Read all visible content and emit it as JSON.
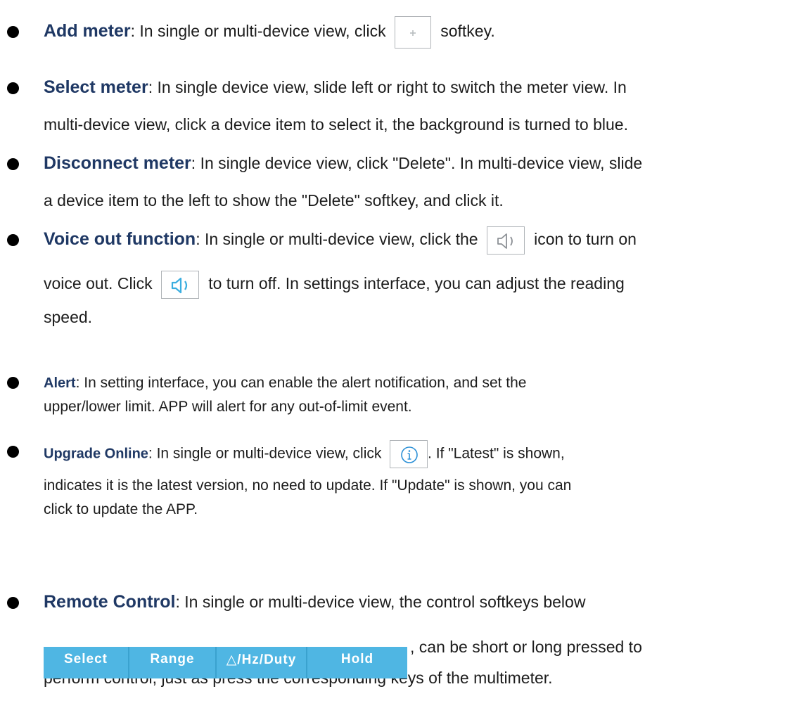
{
  "items": [
    {
      "title": "Add meter",
      "lines": [
        "In single or multi-device view, click",
        "softkey."
      ],
      "icon": "plus-icon"
    },
    {
      "title": "Select meter",
      "lines": [
        ": In single device view, slide left or right to switch the meter view. In",
        "multi-device view, click a device item to select it, the background is turned to blue."
      ]
    },
    {
      "title": "Disconnect meter",
      "lines": [
        ": In single device view, click \"Delete\". In multi-device view, slide",
        "a device item to the left to show the \"Delete\" softkey, and click it."
      ]
    },
    {
      "title": "Voice out function",
      "lines": [
        ": In single or multi-device view, click the",
        "icon to turn on",
        "voice out. Click",
        "to turn off. In settings interface, you can adjust the reading",
        "speed."
      ],
      "icon_off": "speaker-off-icon",
      "icon_on": "speaker-on-icon"
    },
    {
      "title": "Alert",
      "lines": [
        ": In setting interface, you can enable the alert notification, and set the",
        "upper/lower limit. APP will alert for any out-of-limit event."
      ]
    },
    {
      "title": "Upgrade Online",
      "lines": [
        ": In single or multi-device view, click",
        ". If \"Latest\" is shown,",
        "indicates it is the latest version, no need to update. If \"Update\" is shown, you can",
        "click to update the APP."
      ],
      "icon": "info-icon"
    },
    {
      "title": "Remote Control",
      "lines": [
        ": In single or multi-device view, the control softkeys below",
        ", can be short or long pressed to",
        "perform control, just as press the corresponding keys of the multimeter."
      ]
    }
  ],
  "softkeys": [
    "Select",
    "Range",
    "△/Hz/Duty",
    "Hold"
  ],
  "colors": {
    "title": "#1f3864",
    "softkey_bar": "#4fb6e3",
    "speaker_on": "#3aaee0",
    "info": "#2a8fd6"
  }
}
